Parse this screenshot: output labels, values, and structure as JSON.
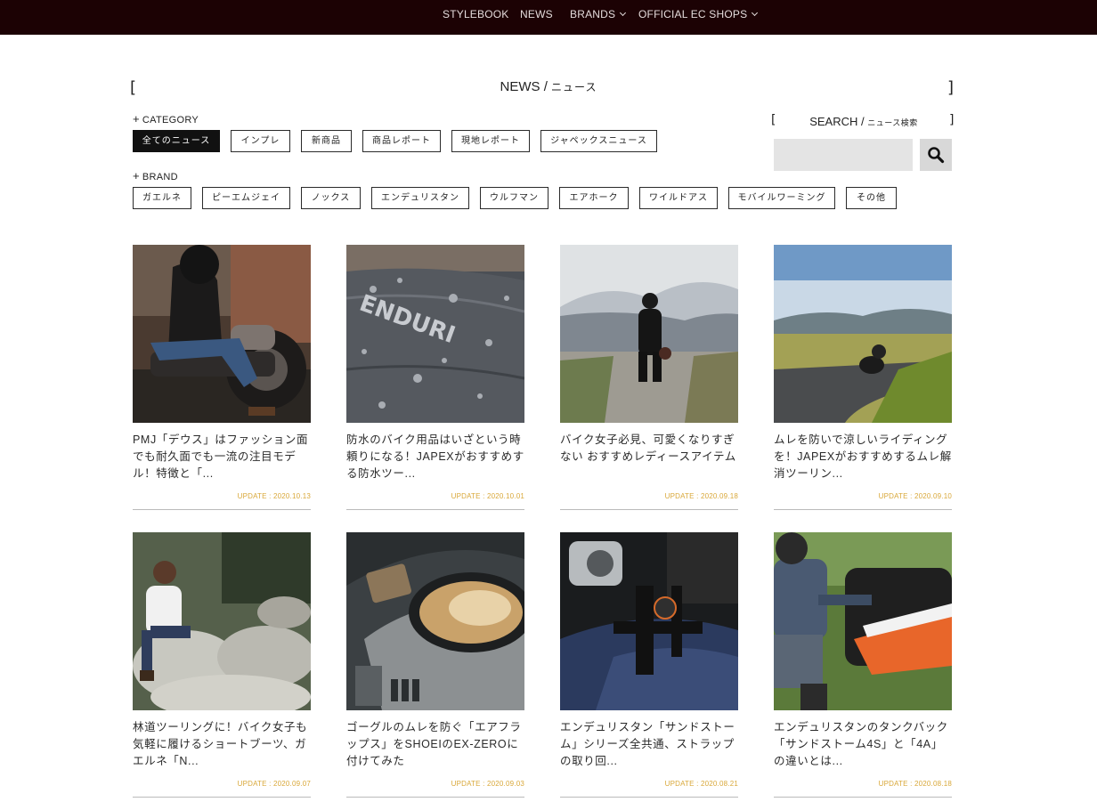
{
  "nav": {
    "items": [
      {
        "label": "STYLEBOOK",
        "dropdown": false
      },
      {
        "label": "NEWS",
        "dropdown": false
      },
      {
        "label": "BRANDS",
        "dropdown": true
      },
      {
        "label": "OFFICIAL EC SHOPS",
        "dropdown": true
      }
    ]
  },
  "header": {
    "bracket_left": "[",
    "bracket_right": "]",
    "title_main": "NEWS / ",
    "title_sub": "ニュース"
  },
  "category": {
    "label": "CATEGORY",
    "tags": [
      {
        "label": "全てのニュース",
        "active": true
      },
      {
        "label": "インプレ",
        "active": false
      },
      {
        "label": "新商品",
        "active": false
      },
      {
        "label": "商品レポート",
        "active": false
      },
      {
        "label": "現地レポート",
        "active": false
      },
      {
        "label": "ジャペックスニュース",
        "active": false
      }
    ]
  },
  "brand": {
    "label": "BRAND",
    "tags": [
      {
        "label": "ガエルネ"
      },
      {
        "label": "ピーエムジェイ"
      },
      {
        "label": "ノックス"
      },
      {
        "label": "エンデュリスタン"
      },
      {
        "label": "ウルフマン"
      },
      {
        "label": "エアホーク"
      },
      {
        "label": "ワイルドアス"
      },
      {
        "label": "モバイルワーミング"
      },
      {
        "label": "その他"
      }
    ]
  },
  "search": {
    "title_main": "SEARCH / ",
    "title_sub": "ニュース検索",
    "placeholder": "",
    "button_icon": "search-icon"
  },
  "articles": [
    {
      "title": "PMJ「デウス」はファッション面でも耐久面でも一流の注目モデル！特徴と「...",
      "date": "UPDATE : 2020.10.13",
      "image": "motorcycle-rider-photo"
    },
    {
      "title": "防水のバイク用品はいざという時頼りになる！JAPEXがおすすめする防水ツー...",
      "date": "UPDATE : 2020.10.01",
      "image": "waterproof-bag-photo"
    },
    {
      "title": "バイク女子必見、可愛くなりすぎない おすすめレディースアイテム",
      "date": "UPDATE : 2020.09.18",
      "image": "woman-landscape-photo"
    },
    {
      "title": "ムレを防いで涼しいライディングを！JAPEXがおすすめするムレ解消ツーリン...",
      "date": "UPDATE : 2020.09.10",
      "image": "rider-road-photo"
    },
    {
      "title": "林道ツーリングに！バイク女子も気軽に履けるショートブーツ、ガエルネ「N...",
      "date": "UPDATE : 2020.09.07",
      "image": "woman-rocks-photo"
    },
    {
      "title": "ゴーグルのムレを防ぐ「エアフラップス」をSHOEIのEX-ZEROに付けてみた",
      "date": "UPDATE : 2020.09.03",
      "image": "goggle-helmet-photo"
    },
    {
      "title": "エンデュリスタン「サンドストーム」シリーズ全共通、ストラップの取り回...",
      "date": "UPDATE : 2020.08.21",
      "image": "tank-strap-photo"
    },
    {
      "title": "エンデュリスタンのタンクバック「サンドストーム4S」と「4A」の違いとは...",
      "date": "UPDATE : 2020.08.18",
      "image": "ktm-rider-photo"
    }
  ],
  "colors": {
    "nav_bg": "#1c0204",
    "date_accent": "#d9a83a",
    "active_tag_bg": "#111111"
  }
}
